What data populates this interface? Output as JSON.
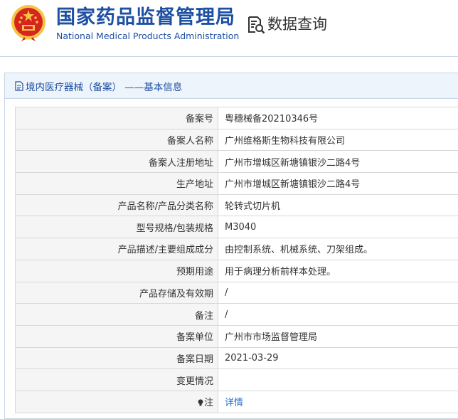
{
  "header": {
    "brand_cn": "国家药品监督管理局",
    "brand_en": "National Medical Products Administration",
    "query_label": "数据查询",
    "emblem_icon": "national-emblem-icon",
    "query_icon": "document-search-icon"
  },
  "panel": {
    "title": "境内医疗器械（备案） ——基本信息",
    "title_icon": "document-icon"
  },
  "rows": [
    {
      "label": "备案号",
      "value": "粤穗械备20210346号"
    },
    {
      "label": "备案人名称",
      "value": "广州维格斯生物科技有限公司"
    },
    {
      "label": "备案人注册地址",
      "value": "广州市增城区新塘镇银沙二路4号"
    },
    {
      "label": "生产地址",
      "value": "广州市增城区新塘镇银沙二路4号"
    },
    {
      "label": "产品名称/产品分类名称",
      "value": "轮转式切片机"
    },
    {
      "label": "型号规格/包装规格",
      "value": "M3040"
    },
    {
      "label": "产品描述/主要组成成分",
      "value": "由控制系统、机械系统、刀架组成。"
    },
    {
      "label": "预期用途",
      "value": "用于病理分析前样本处理。"
    },
    {
      "label": "产品存储及有效期",
      "value": "/"
    },
    {
      "label": "备注",
      "value": "/"
    },
    {
      "label": "备案单位",
      "value": "广州市市场监督管理局"
    },
    {
      "label": "备案日期",
      "value": "2021-03-29"
    },
    {
      "label": "变更情况",
      "value": ""
    }
  ],
  "note_row": {
    "label": "注",
    "link": "详情",
    "icon": "bulb-icon"
  },
  "colors": {
    "brand_blue": "#1d4fa3",
    "panel_head_bg": "#eef4fb",
    "label_bg": "#f5f5f5",
    "border": "#d8d8d8",
    "link": "#2a6fc9",
    "emblem_red": "#d7241f",
    "emblem_gold": "#f3c545"
  }
}
